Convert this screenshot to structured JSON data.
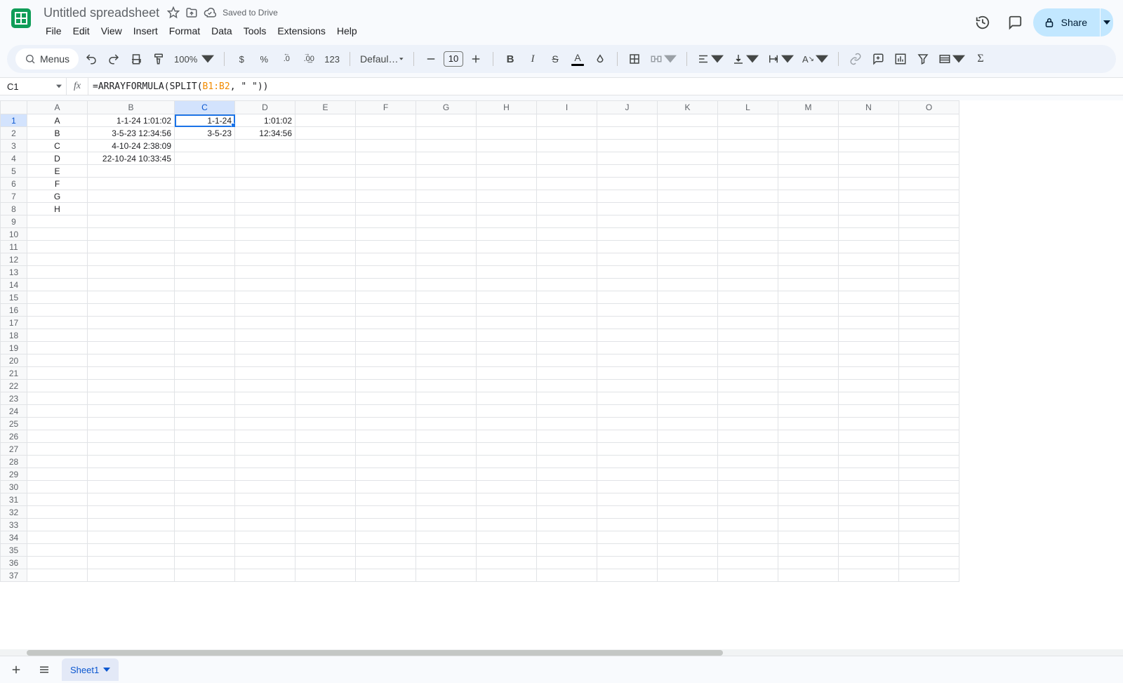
{
  "header": {
    "doc_title": "Untitled spreadsheet",
    "saved_status": "Saved to Drive",
    "menus": [
      "File",
      "Edit",
      "View",
      "Insert",
      "Format",
      "Data",
      "Tools",
      "Extensions",
      "Help"
    ],
    "share_label": "Share"
  },
  "toolbar": {
    "search_label": "Menus",
    "zoom": "100%",
    "currency": "$",
    "percent": "%",
    "dec_decrease": ".0",
    "dec_increase": ".00",
    "format_123": "123",
    "font_name": "Defaul…",
    "font_size": "10"
  },
  "formula_bar": {
    "name_box": "C1",
    "formula_prefix": "=ARRAYFORMULA(SPLIT(",
    "formula_ref": "B1:B2",
    "formula_suffix": ", \" \"))"
  },
  "grid": {
    "column_letters": [
      "A",
      "B",
      "C",
      "D",
      "E",
      "F",
      "G",
      "H",
      "I",
      "J",
      "K",
      "L",
      "M",
      "N",
      "O"
    ],
    "row_count": 37,
    "active_cell": "C1",
    "cells": {
      "A1": "A",
      "A2": "B",
      "A3": "C",
      "A4": "D",
      "A5": "E",
      "A6": "F",
      "A7": "G",
      "A8": "H",
      "B1": "1-1-24 1:01:02",
      "B2": "3-5-23 12:34:56",
      "B3": "4-10-24 2:38:09",
      "B4": "22-10-24 10:33:45",
      "C1": "1-1-24",
      "C2": "3-5-23",
      "D1": "1:01:02",
      "D2": "12:34:56"
    }
  },
  "footer": {
    "sheet_name": "Sheet1"
  }
}
